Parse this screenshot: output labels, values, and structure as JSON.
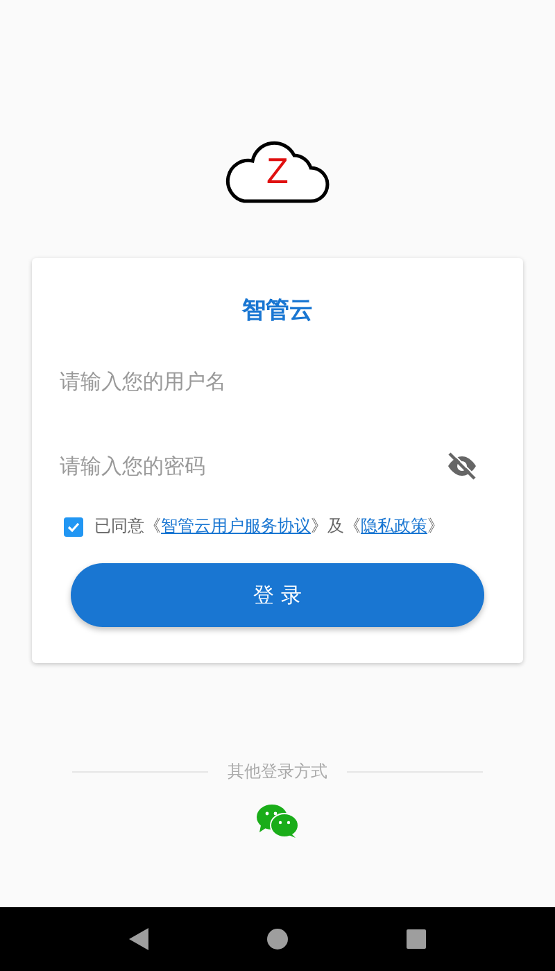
{
  "logo": {
    "letter": "Z"
  },
  "card": {
    "title": "智管云",
    "username": {
      "placeholder": "请输入您的用户名"
    },
    "password": {
      "placeholder": "请输入您的密码",
      "visible": false
    },
    "agreement": {
      "checked": true,
      "parts": [
        {
          "kind": "text",
          "text": "已同意《"
        },
        {
          "kind": "link",
          "text": "智管云用户服务协议"
        },
        {
          "kind": "text",
          "text": "》及《"
        },
        {
          "kind": "link",
          "text": "隐私政策"
        },
        {
          "kind": "text",
          "text": "》"
        }
      ]
    },
    "login_button": "登 录"
  },
  "other_login": {
    "label": "其他登录方式"
  },
  "nav_bar": [
    {
      "kind": "back"
    },
    {
      "kind": "home"
    },
    {
      "kind": "recents"
    }
  ]
}
